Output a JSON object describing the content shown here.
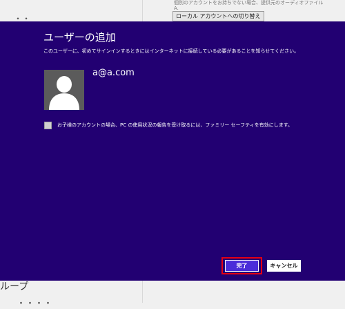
{
  "background": {
    "top_clipped_text": "個別のアカウントをお持ちでない場合、提供元のオーディオファイル",
    "top_clipped_text_2": "A.",
    "local_account_button": "ローカル アカウントへの切り替え",
    "group_label": "ループ",
    "corner_text": "・・",
    "bottom_clipped_text": "・・・・"
  },
  "dialog": {
    "title": "ユーザーの追加",
    "description": "このユーザーに、初めてサインインするときにはインターネットに接続している必要があることを知らせてください。",
    "account_email": "a@a.com",
    "family_safety_label": "お子様のアカウントの場合、PC の使用状況の報告を受け取るには、ファミリー セーフティを有効にします。",
    "family_safety_checked": false,
    "finish_button": "完了",
    "cancel_button": "キャンセル"
  },
  "colors": {
    "dialog_background": "#220072",
    "primary_button": "#4a2dd9",
    "highlight_border": "#e60012",
    "avatar_background": "#5b5b5b"
  },
  "icons": {
    "avatar": "user-silhouette-icon"
  }
}
